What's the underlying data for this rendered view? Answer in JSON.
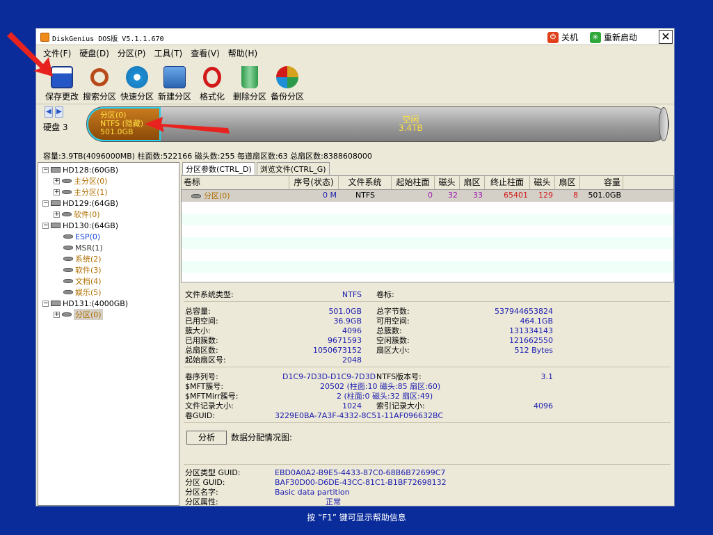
{
  "window": {
    "title": "DiskGenius DOS版 V5.1.1.670",
    "shutdown_label": "关机",
    "restart_label": "重新启动",
    "close_label": "✕"
  },
  "menu": [
    "文件(F)",
    "硬盘(D)",
    "分区(P)",
    "工具(T)",
    "查看(V)",
    "帮助(H)"
  ],
  "toolbar": [
    {
      "label": "保存更改",
      "icon": "save-icon",
      "color": "#2456c6"
    },
    {
      "label": "搜索分区",
      "icon": "magnifier-icon",
      "color": "#b84a1a"
    },
    {
      "label": "快速分区",
      "icon": "disk-icon",
      "color": "#1e8fd6"
    },
    {
      "label": "新建分区",
      "icon": "new-partition-icon",
      "color": "#4a8fd6"
    },
    {
      "label": "格式化",
      "icon": "format-icon",
      "color": "#d31a1a"
    },
    {
      "label": "删除分区",
      "icon": "trash-icon",
      "color": "#2c9a4a"
    },
    {
      "label": "备份分区",
      "icon": "backup-icon",
      "color": "#d6a21e"
    }
  ],
  "diskbar": {
    "disk_label": "硬盘 3",
    "part_name": "分区(0)",
    "part_fs": "NTFS (隐藏)",
    "part_size": "501.0GB",
    "free_label": "空闲",
    "free_size": "3.4TB",
    "capacity_line": "容量:3.9TB(4096000MB)  柱面数:522166  磁头数:255  每道扇区数:63  总扇区数:8388608000"
  },
  "tree": [
    {
      "label": "HD128:(60GB)",
      "kind": "disk",
      "expander": "⊟"
    },
    {
      "label": "主分区(0)",
      "kind": "vol",
      "expander": "+",
      "color": "#b07000"
    },
    {
      "label": "主分区(1)",
      "kind": "vol",
      "expander": "+",
      "color": "#b07000"
    },
    {
      "label": "HD129:(64GB)",
      "kind": "disk",
      "expander": "⊟"
    },
    {
      "label": "软件(0)",
      "kind": "vol",
      "expander": "+",
      "color": "#b07000"
    },
    {
      "label": "HD130:(64GB)",
      "kind": "disk",
      "expander": "⊟"
    },
    {
      "label": "ESP(0)",
      "kind": "vol",
      "expander": "",
      "color": "#1a4ad6"
    },
    {
      "label": "MSR(1)",
      "kind": "vol",
      "expander": "",
      "color": "#333333"
    },
    {
      "label": "系统(2)",
      "kind": "vol",
      "expander": "",
      "color": "#b07000"
    },
    {
      "label": "软件(3)",
      "kind": "vol",
      "expander": "",
      "color": "#b07000"
    },
    {
      "label": "文档(4)",
      "kind": "vol",
      "expander": "",
      "color": "#b07000"
    },
    {
      "label": "娱乐(5)",
      "kind": "vol",
      "expander": "",
      "color": "#b07000"
    },
    {
      "label": "HD131:(4000GB)",
      "kind": "disk",
      "expander": "⊟"
    },
    {
      "label": "分区(0)",
      "kind": "vol",
      "expander": "+",
      "color": "#b07000",
      "selected": true
    }
  ],
  "tabs": [
    "分区参数(CTRL_D)",
    "浏览文件(CTRL_G)"
  ],
  "table": {
    "headers": [
      "卷标",
      "序号(状态)",
      "文件系统",
      "起始柱面",
      "磁头",
      "扇区",
      "终止柱面",
      "磁头",
      "扇区",
      "容量"
    ],
    "row": [
      "分区(0)",
      "0 M",
      "NTFS",
      "0",
      "32",
      "33",
      "65401",
      "129",
      "8",
      "501.0GB"
    ]
  },
  "details": {
    "fs_type_label": "文件系统类型:",
    "fs_type": "NTFS",
    "vol_label_label": "卷标:",
    "total_cap_label": "总容量:",
    "total_cap": "501.0GB",
    "used_label": "已用空间:",
    "used": "36.9GB",
    "cluster_size_label": "簇大小:",
    "cluster_size": "4096",
    "used_clusters_label": "已用簇数:",
    "used_clusters": "9671593",
    "total_sectors_label": "总扇区数:",
    "total_sectors": "1050673152",
    "start_sector_label": "起始扇区号:",
    "start_sector": "2048",
    "total_bytes_label": "总字节数:",
    "total_bytes": "537944653824",
    "free_label": "可用空间:",
    "free": "464.1GB",
    "total_clusters_label": "总簇数:",
    "total_clusters": "131334143",
    "free_clusters_label": "空闲簇数:",
    "free_clusters": "121662550",
    "sector_size_label": "扇区大小:",
    "sector_size": "512 Bytes",
    "serial_label": "卷序列号:",
    "serial": "D1C9-7D3D-D1C9-7D3D",
    "ntfs_ver_label": "NTFS版本号:",
    "ntfs_ver": "3.1",
    "mft_label": "$MFT簇号:",
    "mft": "20502 (柱面:10 磁头:85 扇区:60)",
    "mftmirr_label": "$MFTMirr簇号:",
    "mftmirr": "2 (柱面:0 磁头:32 扇区:49)",
    "frs_label": "文件记录大小:",
    "frs": "1024",
    "idx_label": "索引记录大小:",
    "idx": "4096",
    "guid_label": "卷GUID:",
    "guid": "3229E0BA-7A3F-4332-8C51-11AF096632BC",
    "analyze_label": "分析",
    "alloc_label": "数据分配情况图:",
    "ptype_guid_label": "分区类型 GUID:",
    "ptype_guid": "EBD0A0A2-B9E5-4433-87C0-68B6B72699C7",
    "pguid_label": "分区 GUID:",
    "pguid": "BAF30D00-D6DE-43CC-81C1-B1BF72698132",
    "pname_label": "分区名字:",
    "pname": "Basic data partition",
    "pattr_label": "分区属性:",
    "pattr": "正常"
  },
  "status": "按 “F1” 键可显示帮助信息"
}
